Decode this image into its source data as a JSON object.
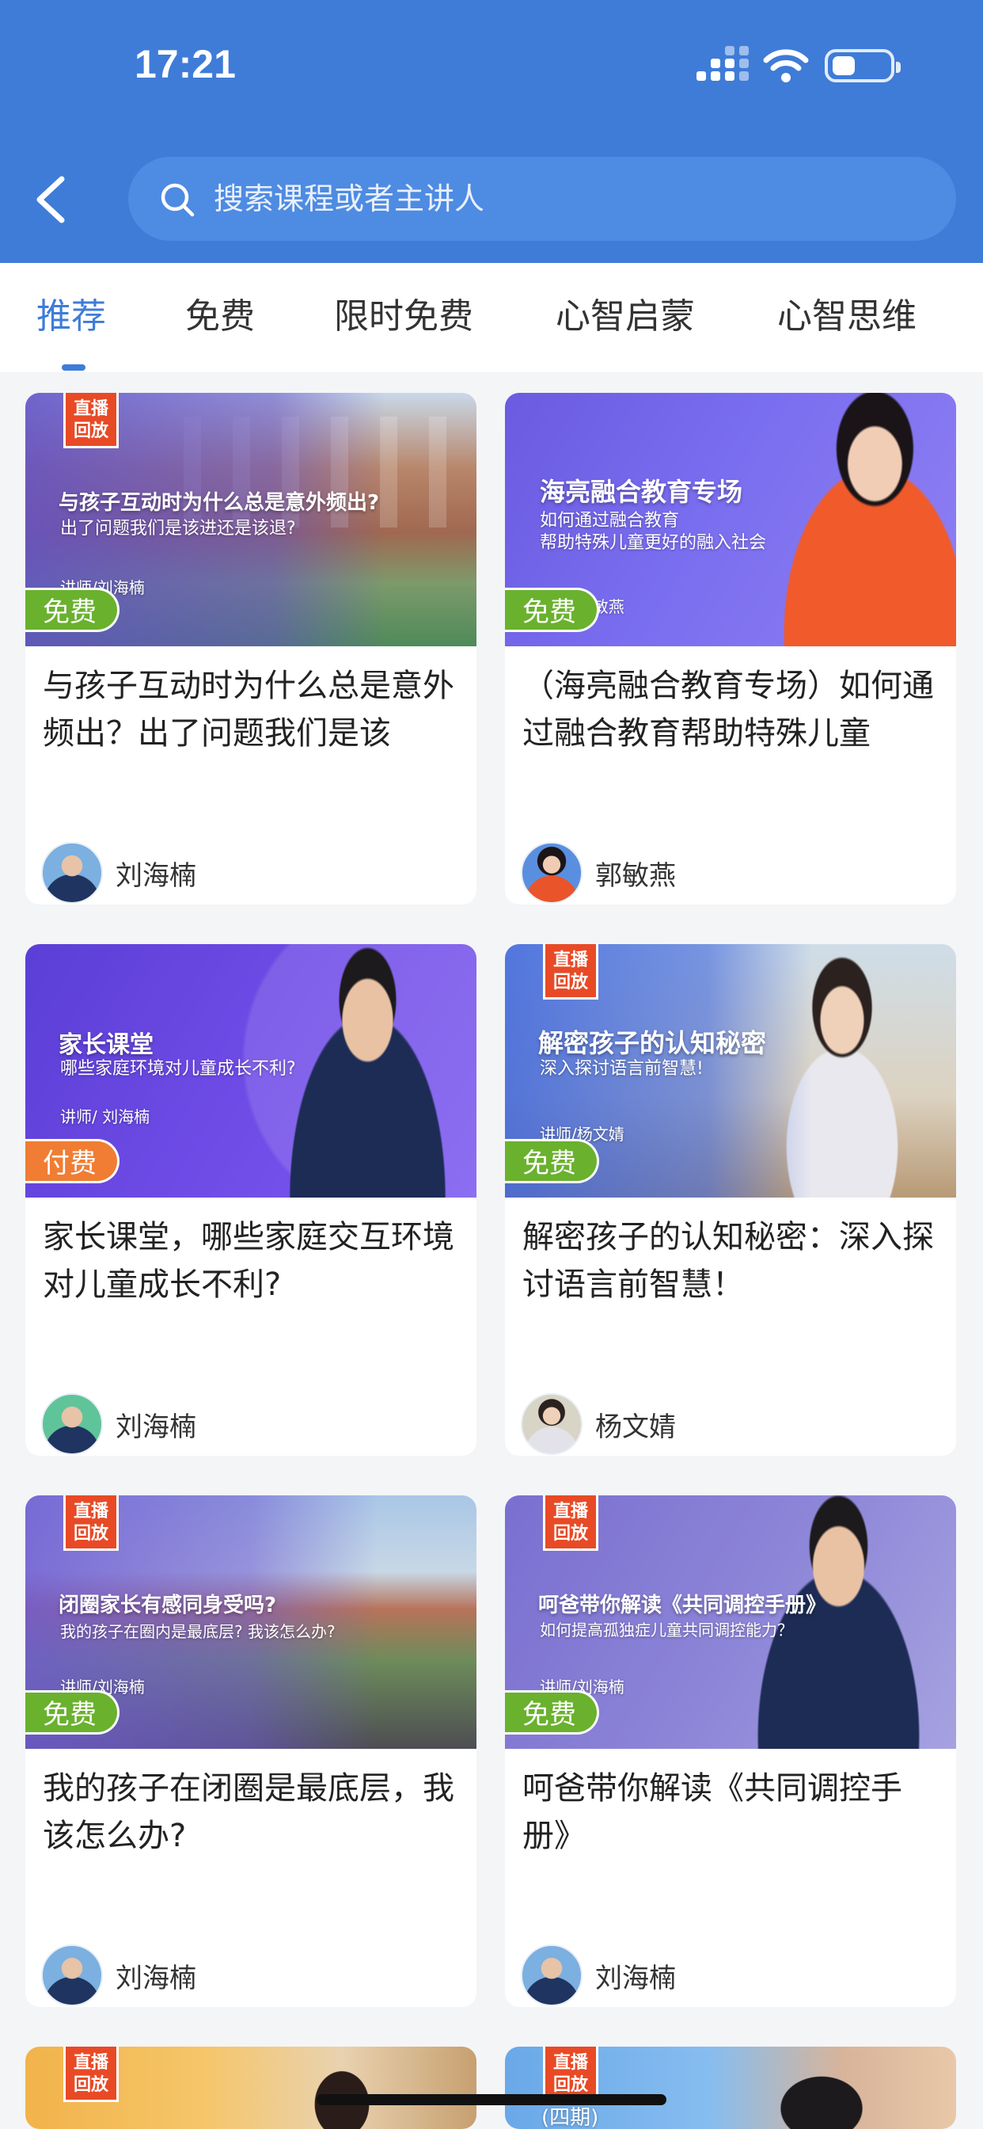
{
  "status_bar": {
    "time": "17:21"
  },
  "search": {
    "placeholder": "搜索课程或者主讲人"
  },
  "tabs": [
    {
      "label": "推荐",
      "active": true
    },
    {
      "label": "免费"
    },
    {
      "label": "限时免费"
    },
    {
      "label": "心智启蒙"
    },
    {
      "label": "心智思维"
    }
  ],
  "colors": {
    "header": "#3e7cd8",
    "free_badge": "#6ab12e",
    "paid_badge": "#f07d33",
    "replay_tag": "#e84a26"
  },
  "courses": [
    {
      "replay_tag": "直播\n回放",
      "thumb_title": "与孩子互动时为什么总是意外频出?",
      "thumb_sub": "出了问题我们是该进还是该退?",
      "thumb_lecturer": "讲师/刘海楠",
      "badge": "免费",
      "title": "与孩子互动时为什么总是意外频出？出了问题我们是该",
      "author": "刘海楠"
    },
    {
      "replay_tag": "",
      "thumb_title": "海亮融合教育专场",
      "thumb_sub": "如何通过融合教育\n帮助特殊儿童更好的融入社会",
      "thumb_lecturer": "讲师/郭敏燕",
      "badge": "免费",
      "title": "（海亮融合教育专场）如何通过融合教育帮助特殊儿童",
      "author": "郭敏燕"
    },
    {
      "replay_tag": "",
      "thumb_title": "家长课堂",
      "thumb_sub": "哪些家庭环境对儿童成长不利?",
      "thumb_lecturer": "讲师/ 刘海楠",
      "badge": "付费",
      "title": "家长课堂，哪些家庭交互环境对儿童成长不利?",
      "author": "刘海楠"
    },
    {
      "replay_tag": "直播\n回放",
      "thumb_title": "解密孩子的认知秘密",
      "thumb_sub": "深入探讨语言前智慧!",
      "thumb_lecturer": "讲师/杨文婧",
      "badge": "免费",
      "title": "解密孩子的认知秘密：深入探讨语言前智慧！",
      "author": "杨文婧"
    },
    {
      "replay_tag": "直播\n回放",
      "thumb_title": "闭圈家长有感同身受吗?",
      "thumb_sub": "我的孩子在圈内是最底层? 我该怎么办?",
      "thumb_lecturer": "讲师/刘海楠",
      "badge": "免费",
      "title": "我的孩子在闭圈是最底层，我该怎么办?",
      "author": "刘海楠"
    },
    {
      "replay_tag": "直播\n回放",
      "thumb_title": "呵爸带你解读《共同调控手册》",
      "thumb_sub": "如何提高孤独症儿童共同调控能力？",
      "thumb_lecturer": "讲师/刘海楠",
      "badge": "免费",
      "title": "呵爸带你解读《共同调控手册》",
      "author": "刘海楠"
    }
  ],
  "partial_cards": [
    {
      "replay_tag": "直播\n回放"
    },
    {
      "replay_tag": "直播\n回放",
      "thumb_text": "(四期)"
    }
  ]
}
